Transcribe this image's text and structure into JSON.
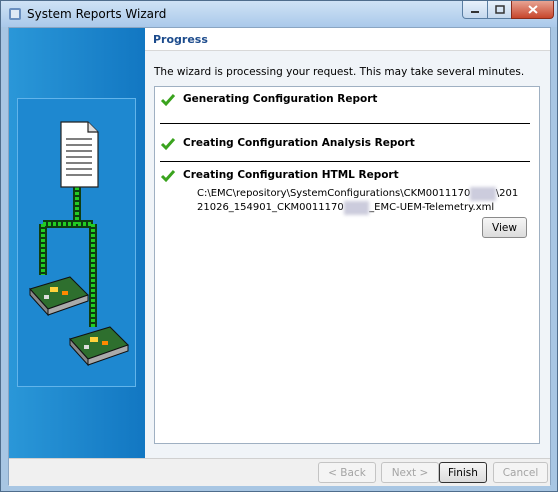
{
  "window": {
    "title": "System Reports Wizard"
  },
  "header": {
    "title": "Progress"
  },
  "intro": "The wizard is processing your request.  This may take several minutes.",
  "steps": [
    {
      "label": "Generating Configuration Report",
      "status": "done"
    },
    {
      "label": "Creating Configuration Analysis Report",
      "status": "done"
    },
    {
      "label": "Creating Configuration HTML Report",
      "status": "done"
    }
  ],
  "output_path": {
    "line1_a": "C:\\EMC\\repository\\SystemConfigurations\\CKM0011170",
    "line1_b": "\\201",
    "line2_a": "21026_154901_CKM0011170",
    "line2_b": "_EMC-UEM-Telemetry.xml"
  },
  "buttons": {
    "view": "View",
    "back": "< Back",
    "next": "Next >",
    "finish": "Finish",
    "cancel": "Cancel"
  },
  "colors": {
    "check": "#3aa31e",
    "accent": "#1c4b8c",
    "connector": "#22cc22"
  },
  "icons": [
    "app-icon",
    "check-icon",
    "document-icon",
    "circuit-board-icon"
  ]
}
